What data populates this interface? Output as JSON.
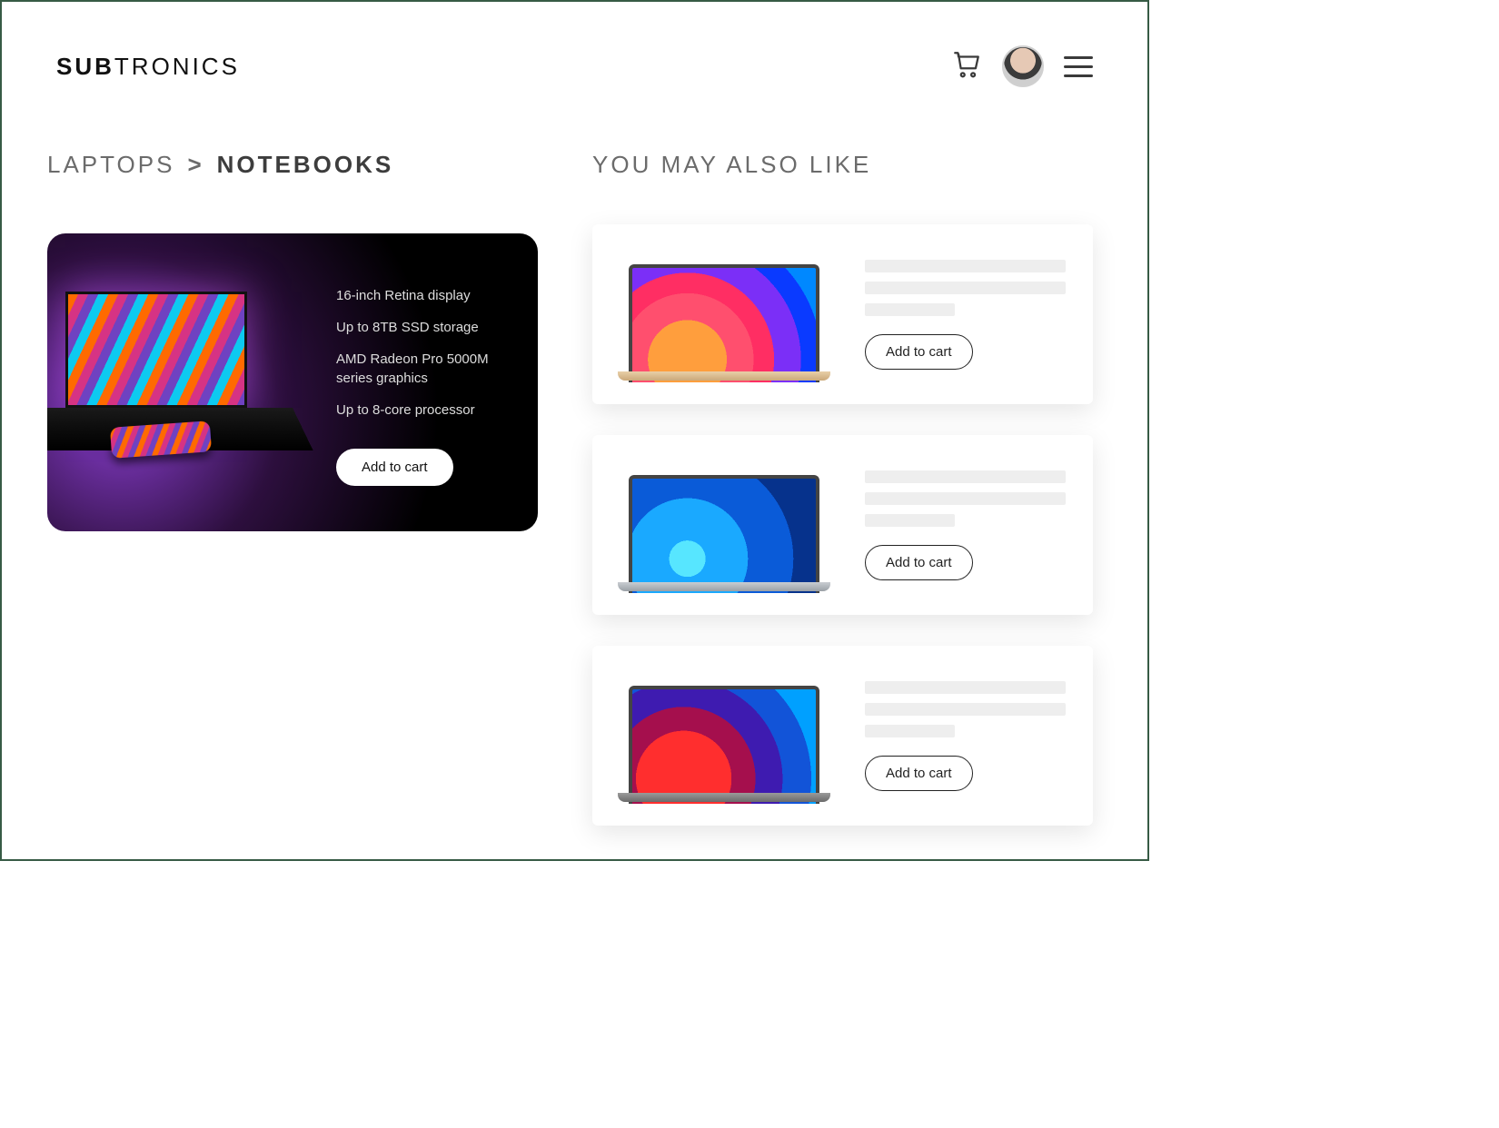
{
  "header": {
    "logo_bold": "SUB",
    "logo_light": "TRONICS"
  },
  "breadcrumb": {
    "parent": "LAPTOPS",
    "separator": ">",
    "current": "NOTEBOOKS"
  },
  "hero": {
    "specs": [
      "16-inch Retina display",
      "Up to 8TB SSD storage",
      "AMD Radeon Pro 5000M series graphics",
      "Up to 8-core processor"
    ],
    "cta": "Add to cart"
  },
  "recommend": {
    "title": "YOU MAY ALSO LIKE",
    "items": [
      {
        "cta": "Add to cart"
      },
      {
        "cta": "Add to cart"
      },
      {
        "cta": "Add to cart"
      }
    ]
  }
}
